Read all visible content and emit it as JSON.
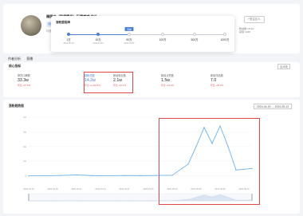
{
  "profile": {
    "name": "雅丽才（现货精品）玩偶商城 店长",
    "tag": "品牌",
    "meta": "抖音号：xxxx"
  },
  "header": {
    "count": "15个",
    "active": "我的直播间",
    "follow": "+关注达人",
    "stats": [
      "粉丝数 15.2w",
      "获赞 1240"
    ]
  },
  "popup": {
    "title": "涨粉里程碑",
    "flag": "当前",
    "milestones": [
      {
        "label": "1万",
        "sub": "2023-05-19",
        "done": true
      },
      {
        "label": "10万",
        "sub": "2023-11-24",
        "done": true
      },
      {
        "label": "50万",
        "sub": "2024-03-07",
        "done": false
      },
      {
        "label": "100万",
        "sub": "",
        "done": false
      },
      {
        "label": "500万",
        "sub": "",
        "done": false
      },
      {
        "label": "1000万",
        "sub": "",
        "done": false
      }
    ]
  },
  "tabs": [
    "作者分析",
    "直播"
  ],
  "metrics": {
    "title": "核心指标",
    "period": "近15天",
    "items": [
      {
        "label": "带货口碑数",
        "value": "33.3w",
        "change": "环比 +87.6%",
        "active": false
      },
      {
        "label": "增粉总数",
        "value": "14.2w",
        "change": "环比 +2,432.5%",
        "active": true
      },
      {
        "label": "新增粉丝数",
        "value": "2.1w",
        "change": "环比 +31.2%",
        "active": false
      },
      {
        "label": "新增点赞数",
        "value": "1.5w",
        "change": "环比 +22.4%",
        "active": false
      },
      {
        "label": "新增作品数",
        "value": "7.0",
        "change": "环比 +40.0%",
        "active": false
      }
    ]
  },
  "chart": {
    "title": "涨粉趋势图",
    "date_range": "2024-04-15  →  2024-05-13"
  },
  "chart_data": {
    "type": "line",
    "title": "涨粉趋势图",
    "x": [
      "2024-04-15",
      "2024-04-17",
      "2024-04-19",
      "2024-04-21",
      "2024-04-23",
      "2024-04-25",
      "2024-04-27",
      "2024-04-29",
      "2024-05-01",
      "2024-05-03",
      "2024-05-05",
      "2024-05-06",
      "2024-05-07",
      "2024-05-08",
      "2024-05-09",
      "2024-05-10",
      "2024-05-11",
      "2024-05-12",
      "2024-05-13"
    ],
    "x_tick_labels": [
      "2024-04-15",
      "2024-04-18",
      "2024-04-21",
      "2024-04-24",
      "2024-04-27",
      "2024-04-30",
      "2024-05-03",
      "2024-05-06",
      "2024-05-09",
      "2024-05-12"
    ],
    "series": [
      {
        "values": [
          0,
          100,
          300,
          600,
          200,
          100,
          300,
          200,
          300,
          400,
          8000,
          20000,
          33000,
          22000,
          34000,
          20000,
          4000,
          4500,
          5000
        ]
      }
    ],
    "y_ticks": [
      "0",
      "1w",
      "2w",
      "3w",
      "4w"
    ],
    "ylim": [
      -4000,
      40000
    ],
    "grid": true,
    "color": "#58a9f0"
  }
}
